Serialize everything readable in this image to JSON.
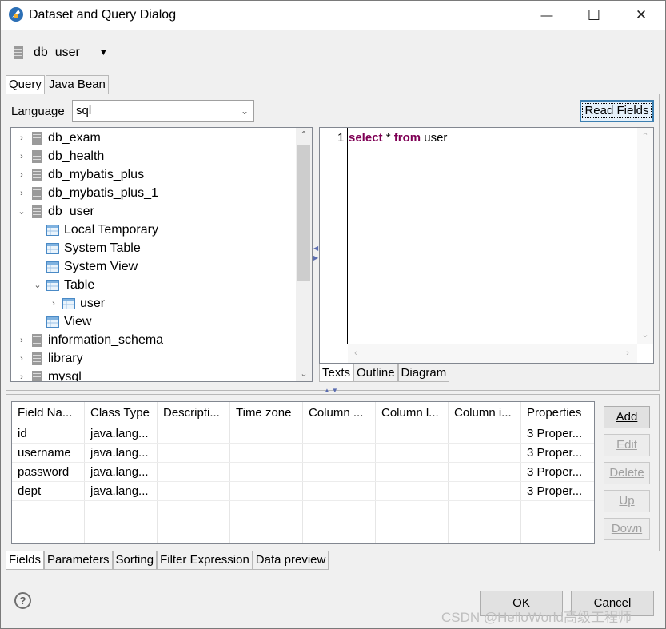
{
  "window": {
    "title": "Dataset and Query Dialog",
    "minimize_glyph": "—",
    "maximize_glyph": "☐",
    "close_glyph": "✕"
  },
  "datasource": {
    "name": "db_user",
    "dropdown_glyph": "▼"
  },
  "top_tabs": [
    {
      "label": "Query",
      "active": true
    },
    {
      "label": "Java Bean",
      "active": false
    }
  ],
  "language": {
    "label": "Language",
    "value": "sql"
  },
  "read_fields_label": "Read Fields",
  "tree": {
    "items": [
      {
        "label": "db_exam",
        "icon": "database-icon",
        "twisty": "›",
        "level": 0
      },
      {
        "label": "db_health",
        "icon": "database-icon",
        "twisty": "›",
        "level": 0
      },
      {
        "label": "db_mybatis_plus",
        "icon": "database-icon",
        "twisty": "›",
        "level": 0
      },
      {
        "label": "db_mybatis_plus_1",
        "icon": "database-icon",
        "twisty": "›",
        "level": 0
      },
      {
        "label": "db_user",
        "icon": "database-icon",
        "twisty": "⌄",
        "level": 0
      },
      {
        "label": "Local Temporary",
        "icon": "table-icon",
        "twisty": "",
        "level": 1
      },
      {
        "label": "System Table",
        "icon": "table-icon",
        "twisty": "",
        "level": 1
      },
      {
        "label": "System View",
        "icon": "table-icon",
        "twisty": "",
        "level": 1
      },
      {
        "label": "Table",
        "icon": "table-icon",
        "twisty": "⌄",
        "level": 1
      },
      {
        "label": "user",
        "icon": "table-icon",
        "twisty": "›",
        "level": 2
      },
      {
        "label": "View",
        "icon": "table-icon",
        "twisty": "",
        "level": 1
      },
      {
        "label": "information_schema",
        "icon": "database-icon",
        "twisty": "›",
        "level": 0
      },
      {
        "label": "library",
        "icon": "database-icon",
        "twisty": "›",
        "level": 0
      },
      {
        "label": "mysql",
        "icon": "database-icon",
        "twisty": "›",
        "level": 0
      }
    ]
  },
  "editor": {
    "line_number": "1",
    "tokens": [
      {
        "text": "select",
        "kw": true
      },
      {
        "text": " * ",
        "kw": false
      },
      {
        "text": "from",
        "kw": true
      },
      {
        "text": " user",
        "kw": false
      }
    ],
    "tabs": [
      {
        "label": "Texts",
        "active": true
      },
      {
        "label": "Outline",
        "active": false
      },
      {
        "label": "Diagram",
        "active": false
      }
    ]
  },
  "fields_table": {
    "columns": [
      "Field Na...",
      "Class Type",
      "Descripti...",
      "Time zone",
      "Column ...",
      "Column l...",
      "Column i...",
      "Properties"
    ],
    "rows": [
      [
        "id",
        "java.lang...",
        "",
        "",
        "",
        "",
        "",
        "3 Proper..."
      ],
      [
        "username",
        "java.lang...",
        "",
        "",
        "",
        "",
        "",
        "3 Proper..."
      ],
      [
        "password",
        "java.lang...",
        "",
        "",
        "",
        "",
        "",
        "3 Proper..."
      ],
      [
        "dept",
        "java.lang...",
        "",
        "",
        "",
        "",
        "",
        "3 Proper..."
      ]
    ]
  },
  "side_buttons": [
    {
      "label": "Add",
      "enabled": true
    },
    {
      "label": "Edit",
      "enabled": false
    },
    {
      "label": "Delete",
      "enabled": false
    },
    {
      "label": "Up",
      "enabled": false
    },
    {
      "label": "Down",
      "enabled": false
    }
  ],
  "bottom_tabs": [
    {
      "label": "Fields",
      "active": true
    },
    {
      "label": "Parameters",
      "active": false
    },
    {
      "label": "Sorting",
      "active": false
    },
    {
      "label": "Filter Expression",
      "active": false
    },
    {
      "label": "Data preview",
      "active": false
    }
  ],
  "help_glyph": "?",
  "ok_label": "OK",
  "cancel_label": "Cancel",
  "watermark": "CSDN @HelloWorld高级工程师"
}
